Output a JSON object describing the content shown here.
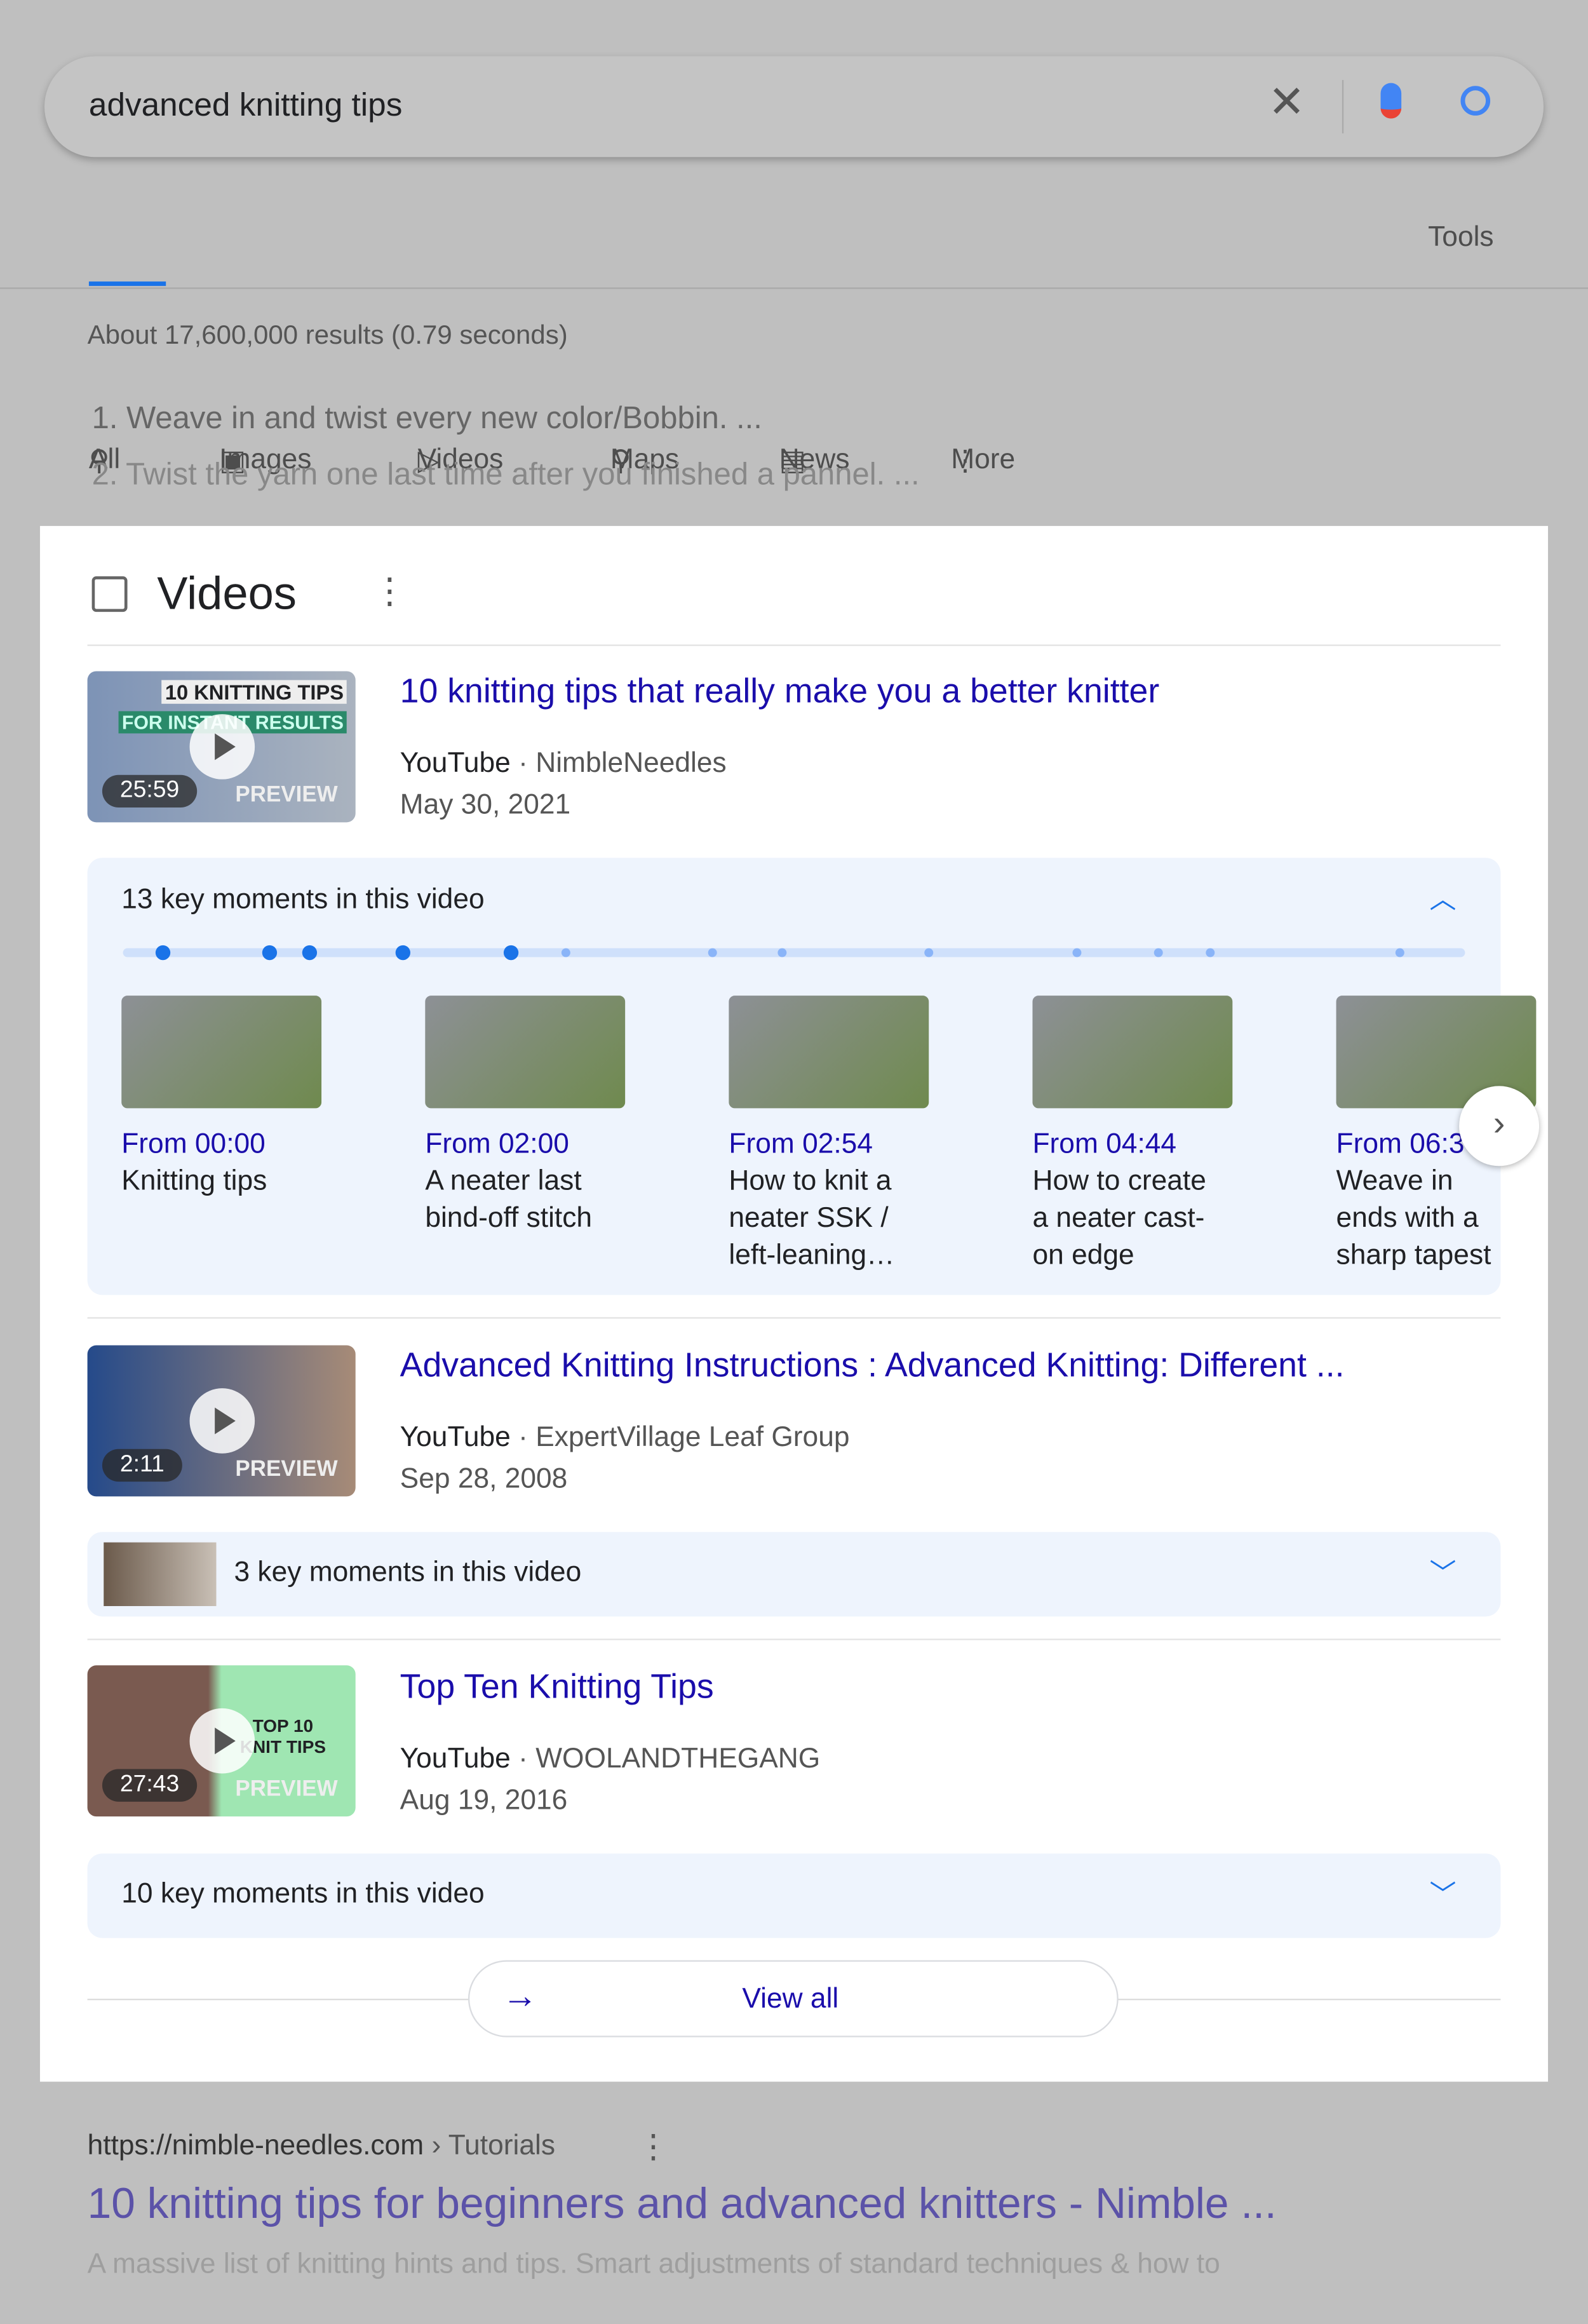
{
  "search": {
    "query": "advanced knitting tips"
  },
  "tabs": [
    {
      "label": "All",
      "icon": "search-icon",
      "active": true
    },
    {
      "label": "Images",
      "icon": "image-icon"
    },
    {
      "label": "Videos",
      "icon": "video-icon"
    },
    {
      "label": "Maps",
      "icon": "map-pin-icon"
    },
    {
      "label": "News",
      "icon": "news-icon"
    },
    {
      "label": "More",
      "icon": "more-vert-icon"
    }
  ],
  "tools": "Tools",
  "result_stats": "About 17,600,000 results (0.79 seconds)",
  "snippet_list": [
    "1. Weave in and twist every new color/Bobbin. ...",
    "2. Twist the yarn one last time after you finished a pannel. ..."
  ],
  "videos": {
    "title": "Videos",
    "items": [
      {
        "title": "10 knitting tips that really make you a better knitter",
        "source": "YouTube",
        "channel": "NimbleNeedles",
        "date": "May 30, 2021",
        "duration": "25:59",
        "preview": "PREVIEW",
        "thumb_text": [
          "10 KNITTING TIPS",
          "FOR INSTANT RESULTS"
        ],
        "key_moments": "13 key moments in this video",
        "expanded": true,
        "moments": [
          {
            "time": "From 00:00",
            "desc": [
              "Knitting tips"
            ]
          },
          {
            "time": "From 02:00",
            "desc": [
              "A neater last",
              "bind-off stitch"
            ]
          },
          {
            "time": "From 02:54",
            "desc": [
              "How to knit a",
              "neater SSK /",
              "left-leaning…"
            ]
          },
          {
            "time": "From 04:44",
            "desc": [
              "How to create",
              "a neater cast-",
              "on edge"
            ]
          },
          {
            "time": "From 06:3",
            "desc": [
              "Weave in",
              "ends with a",
              "sharp tapest"
            ]
          }
        ]
      },
      {
        "title": "Advanced Knitting Instructions : Advanced Knitting: Different ...",
        "source": "YouTube",
        "channel": "ExpertVillage Leaf Group",
        "date": "Sep 28, 2008",
        "duration": "2:11",
        "preview": "PREVIEW",
        "key_moments": "3 key moments in this video"
      },
      {
        "title": "Top Ten Knitting Tips",
        "source": "YouTube",
        "channel": "WOOLANDTHEGANG",
        "date": "Aug 19, 2016",
        "duration": "27:43",
        "preview": "PREVIEW",
        "thumb_text": [
          "TOP 10",
          "KNIT TIPS"
        ],
        "key_moments": "10 key moments in this video"
      }
    ],
    "view_all": "View all"
  },
  "organic": {
    "url": "https://nimble-needles.com",
    "breadcrumb": "› Tutorials",
    "title": "10 knitting tips for beginners and advanced knitters - Nimble ...",
    "snippet": "A massive list of knitting hints and tips. Smart adjustments of standard techniques & how to"
  },
  "colors": {
    "link": "#1a0dab",
    "accent": "#1a73e8",
    "keymoment_bg": "#eef4fd"
  }
}
